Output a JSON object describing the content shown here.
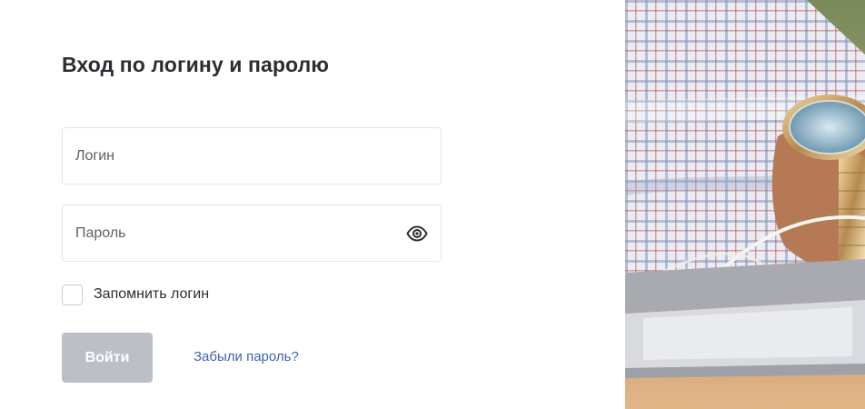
{
  "login_form": {
    "title": "Вход по логину и паролю",
    "login_field": {
      "placeholder": "Логин",
      "value": ""
    },
    "password_field": {
      "placeholder": "Пароль",
      "value": "",
      "toggle_icon": "eye-icon"
    },
    "remember": {
      "label": "Запомнить логин",
      "checked": false
    },
    "submit_label": "Войти",
    "forgot_label": "Забыли пароль?"
  },
  "colors": {
    "submit_disabled_bg": "#bcbfc6",
    "link": "#3b64b0",
    "field_border": "#e3e5ea"
  },
  "side_image": {
    "subject": "photo-wristwatch-laptop"
  }
}
